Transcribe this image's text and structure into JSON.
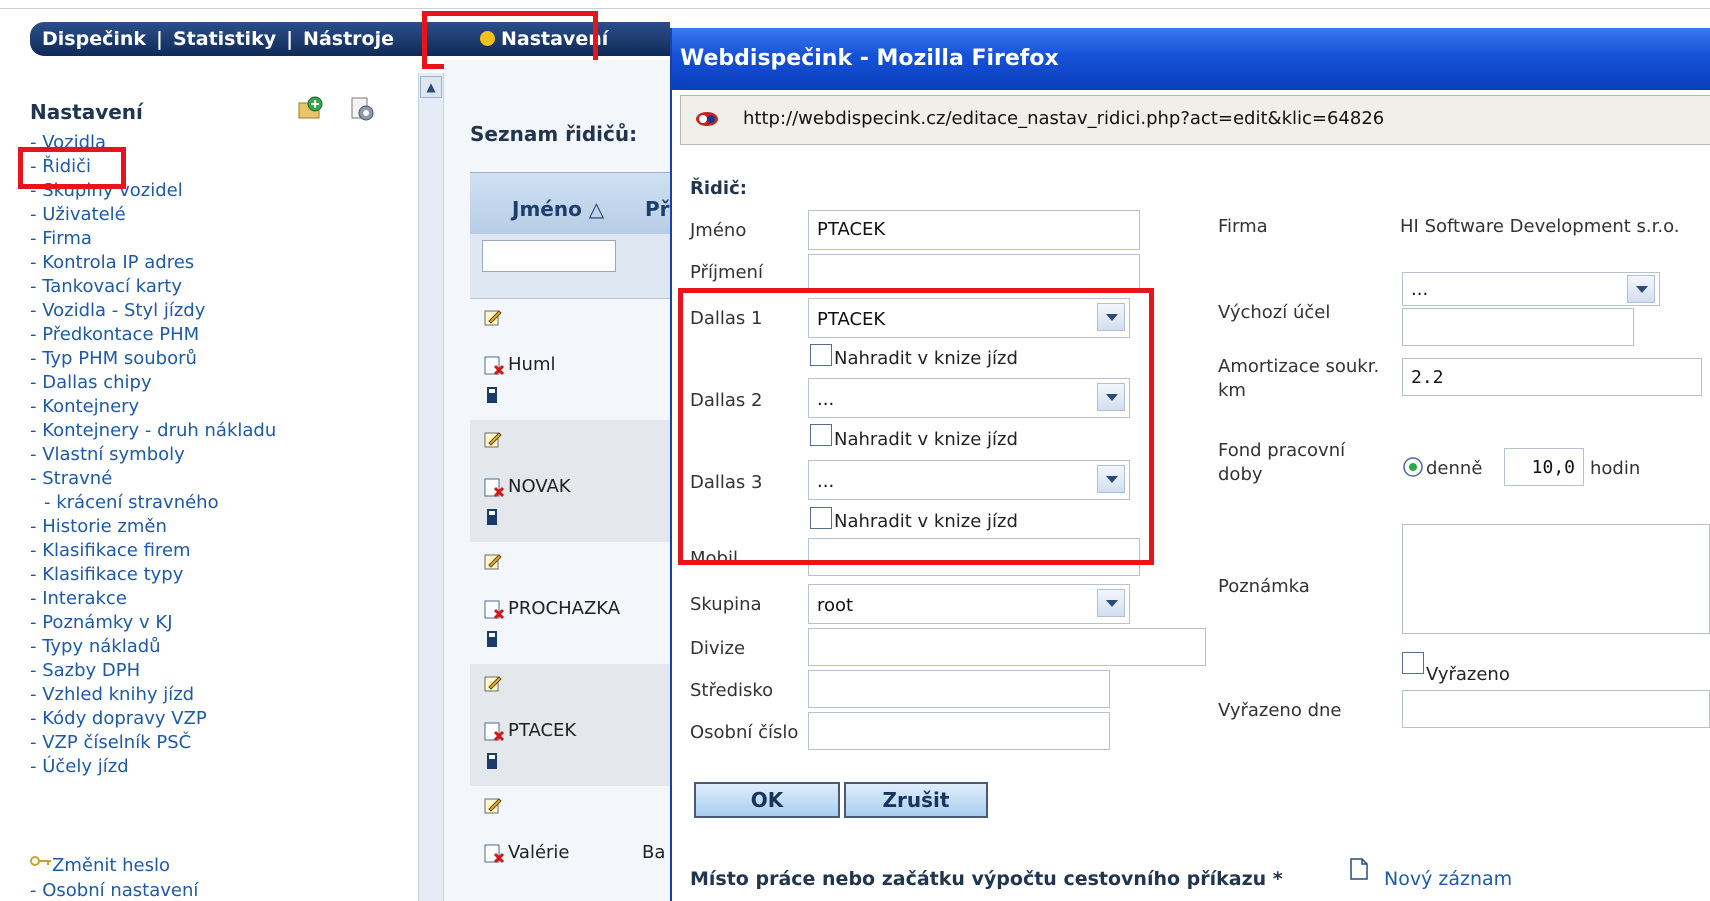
{
  "nav": {
    "items": [
      "Dispečink",
      "Statistiky",
      "Nástroje"
    ],
    "separator": "|",
    "active": "Nastavení",
    "active_dot_color": "#f2c11c"
  },
  "sidebar": {
    "title": "Nastavení",
    "items": [
      "- Vozidla",
      "- Řidiči",
      "- Skupiny vozidel",
      "- Uživatelé",
      "- Firma",
      "- Kontrola IP adres",
      "- Tankovací karty",
      "- Vozidla - Styl jízdy",
      "- Předkontace PHM",
      "- Typ PHM souborů",
      "- Dallas chipy",
      "- Kontejnery",
      "- Kontejnery - druh nákladu",
      "- Vlastní symboly",
      "- Stravné",
      "- krácení stravného",
      "- Historie změn",
      "- Klasifikace firem",
      "- Klasifikace typy",
      "- Interakce",
      "- Poznámky v KJ",
      "- Typy nákladů",
      "- Sazby DPH",
      "- Vzhled knihy jízd",
      "- Kódy dopravy VZP",
      "- VZP číselník PSČ",
      "- Účely jízd"
    ],
    "change_password": "Změnit heslo",
    "personal_settings": "- Osobní nastavení"
  },
  "list": {
    "title": "Seznam řidičů:",
    "column_name": "Jméno △",
    "column_next": "Př",
    "rows": [
      "Huml",
      "NOVAK",
      "PROCHAZKA",
      "PTACEK",
      "Valérie"
    ],
    "last_row_extra": "Ba"
  },
  "window": {
    "title": "Webdispečink - Mozilla Firefox",
    "url": "http://webdispecink.cz/editace_nastav_ridici.php?act=edit&klic=64826"
  },
  "form": {
    "section": "Řidič:",
    "jmeno_label": "Jméno",
    "jmeno_value": "PTACEK",
    "prijmeni_label": "Příjmení",
    "prijmeni_value": "",
    "dallas1_label": "Dallas 1",
    "dallas1_value": "PTACEK",
    "dallas2_label": "Dallas 2",
    "dallas2_value": "...",
    "dallas3_label": "Dallas 3",
    "dallas3_value": "...",
    "replace_label": "Nahradit v knize jízd",
    "mobil_label": "Mobil",
    "skupina_label": "Skupina",
    "skupina_value": "root",
    "divize_label": "Divize",
    "stredisko_label": "Středisko",
    "osobni_cislo_label": "Osobní číslo",
    "firma_label": "Firma",
    "firma_value": "HI Software Development s.r.o.",
    "vychozi_ucel_label": "Výchozí účel",
    "vychozi_ucel_value": "...",
    "amortizace_label_1": "Amortizace soukr.",
    "amortizace_label_2": "km",
    "amortizace_value": "2.2",
    "fond_label_1": "Fond pracovní",
    "fond_label_2": "doby",
    "fond_radio_label": "denně",
    "fond_value": "10,0",
    "fond_unit": "hodin",
    "poznamka_label": "Poznámka",
    "vyrazeno_label": "Vyřazeno",
    "vyrazeno_dne_label": "Vyřazeno dne",
    "ok_label": "OK",
    "cancel_label": "Zrušit",
    "bottom_label": "Místo práce nebo začátku výpočtu cestovního příkazu *",
    "new_record_label": "Nový záznam"
  },
  "colors": {
    "highlight": "#e8141b",
    "link": "#1e5aa6",
    "titlebar": "#1551d6"
  }
}
